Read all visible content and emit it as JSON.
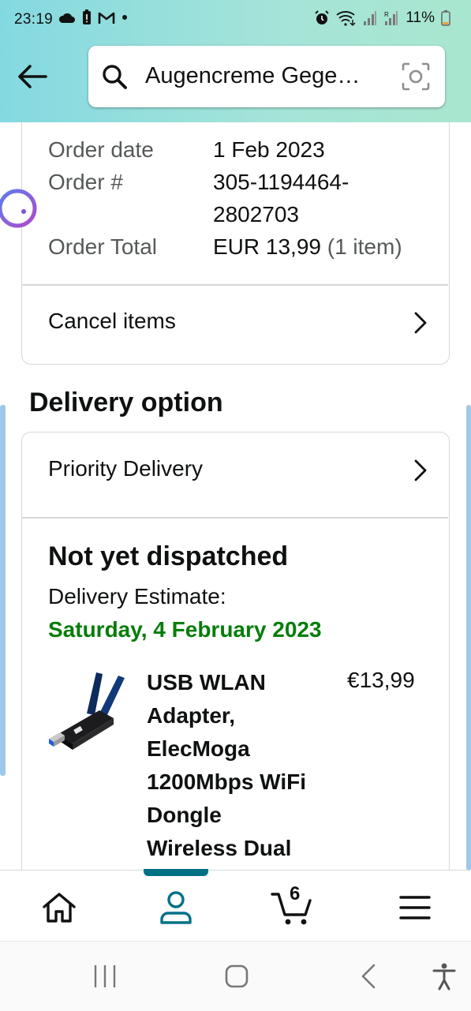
{
  "status_bar": {
    "time": "23:19",
    "battery": "11%",
    "left_icons": [
      "cloud-icon",
      "battery-alert-icon",
      "gmail-icon",
      "dot-icon"
    ],
    "right_icons": [
      "alarm-icon",
      "wifi-icon",
      "signal-icon",
      "signal-roaming-icon",
      "battery-icon"
    ]
  },
  "header": {
    "search_text": "Augencreme Gege…",
    "accent_color": "#84d9e1"
  },
  "order_info": {
    "rows": [
      {
        "label": "Order date",
        "value": "1 Feb 2023"
      },
      {
        "label": "Order #",
        "value_line1": "305-1194464-",
        "value_line2": "2802703"
      },
      {
        "label": "Order Total",
        "value": "EUR 13,99",
        "value_extra": "(1 item)"
      }
    ],
    "cancel_label": "Cancel items"
  },
  "delivery": {
    "section_title": "Delivery option",
    "option_label": "Priority Delivery",
    "status_title": "Not yet dispatched",
    "estimate_label": "Delivery Estimate:",
    "estimate_date": "Saturday, 4 February 2023",
    "estimate_color": "#067d0a"
  },
  "product": {
    "title_lines": [
      "USB WLAN",
      "Adapter,",
      "ElecMoga",
      "1200Mbps WiFi",
      "Dongle",
      "Wireless Dual"
    ],
    "price": "€13,99"
  },
  "bottom_nav": {
    "items": [
      "home-icon",
      "account-icon",
      "cart-icon",
      "menu-icon"
    ],
    "active": "account",
    "cart_count": "6",
    "active_color": "#007185"
  },
  "system_nav": [
    "recents-icon",
    "home-circle-icon",
    "back-icon",
    "accessibility-icon"
  ]
}
